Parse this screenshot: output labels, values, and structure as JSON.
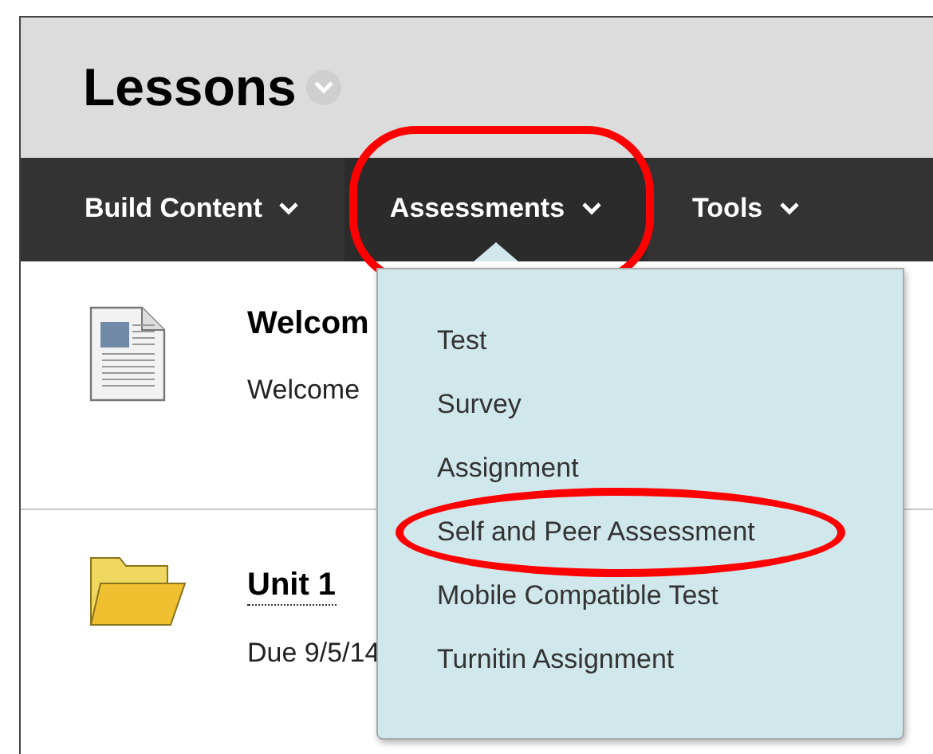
{
  "page": {
    "title": "Lessons"
  },
  "nav": [
    {
      "label": "Build Content",
      "selected": false,
      "highlighted": false
    },
    {
      "label": "Assessments",
      "selected": true,
      "highlighted": true
    },
    {
      "label": "Tools",
      "selected": false,
      "highlighted": false
    }
  ],
  "content": [
    {
      "kind": "document",
      "title": "Welcom",
      "text": "Welcome",
      "link": false
    },
    {
      "kind": "folder",
      "title": "Unit 1",
      "text": "Due 9/5/14",
      "link": true
    }
  ],
  "menu": [
    {
      "label": "Test",
      "highlighted": false
    },
    {
      "label": "Survey",
      "highlighted": false
    },
    {
      "label": "Assignment",
      "highlighted": false
    },
    {
      "label": "Self and Peer Assessment",
      "highlighted": true
    },
    {
      "label": "Mobile Compatible Test",
      "highlighted": false
    },
    {
      "label": "Turnitin Assignment",
      "highlighted": false
    }
  ]
}
